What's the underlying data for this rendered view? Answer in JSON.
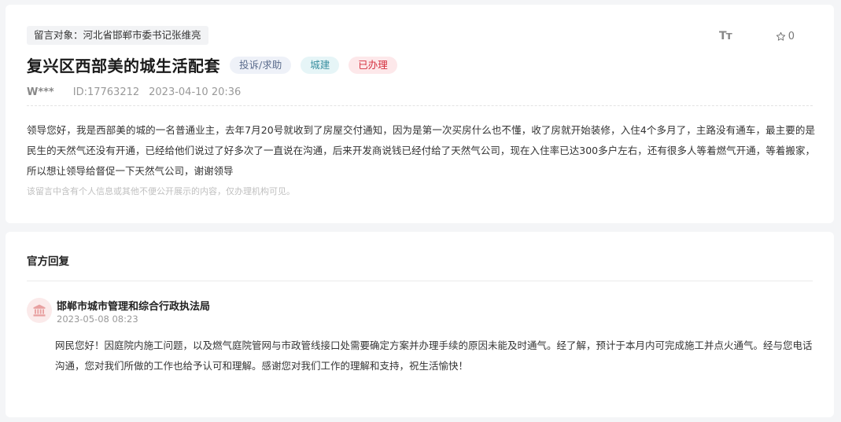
{
  "message": {
    "target_tag": "留言对象：河北省邯郸市委书记张维亮",
    "font_tool_label": "Tт",
    "favorite_count": "0",
    "title": "复兴区西部美的城生活配套",
    "badges": {
      "category": "投诉/求助",
      "field": "城建",
      "status": "已办理"
    },
    "badge_colors": {
      "category_bg": "#eef1f8",
      "field_bg": "#e6f5f7",
      "status_bg": "#fde8ea",
      "status_text": "#d4303f"
    },
    "user": "W***",
    "id_text": "ID:17763212",
    "datetime": "2023-04-10 20:36",
    "content": "领导您好，我是西部美的城的一名普通业主，去年7月20号就收到了房屋交付通知，因为是第一次买房什么也不懂，收了房就开始装修，入住4个多月了，主路没有通车，最主要的是民生的天然气还没有开通，已经给他们说过了好多次了一直说在沟通，后来开发商说钱已经付给了天然气公司，现在入住率已达300多户左右，还有很多人等着燃气开通，等着搬家，所以想让领导给督促一下天然气公司，谢谢领导",
    "privacy_notice": "该留言中含有个人信息或其他不便公开展示的内容，仅办理机构可见。"
  },
  "reply": {
    "section_title": "官方回复",
    "department": "邯郸市城市管理和综合行政执法局",
    "datetime": "2023-05-08 08:23",
    "content": "网民您好！因庭院内施工问题，以及燃气庭院管网与市政管线接口处需要确定方案并办理手续的原因未能及时通气。经了解，预计于本月内可完成施工并点火通气。经与您电话沟通，您对我们所做的工作也给予认可和理解。感谢您对我们工作的理解和支持，祝生活愉快！",
    "icon": "government-building-icon",
    "icon_color": "#e8a0a0"
  }
}
